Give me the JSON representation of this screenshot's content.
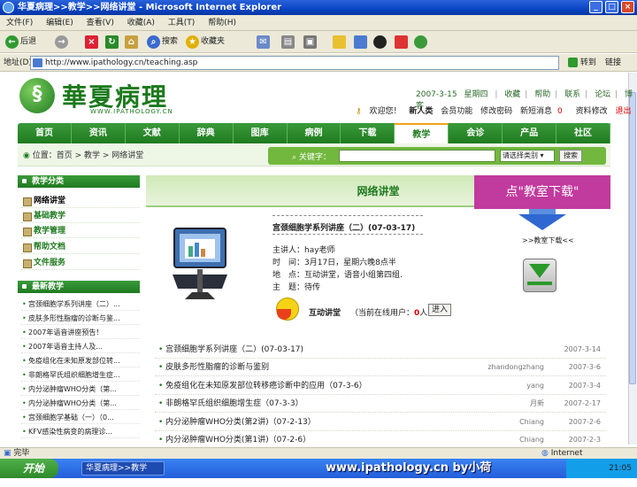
{
  "window": {
    "title": "华夏病理>>教学>>网络讲堂 - Microsoft Internet Explorer"
  },
  "menu": [
    "文件(F)",
    "编辑(E)",
    "查看(V)",
    "收藏(A)",
    "工具(T)",
    "帮助(H)"
  ],
  "toolbar": {
    "back": "后退",
    "search": "搜索",
    "favorites": "收藏夹"
  },
  "address": {
    "label": "地址(D)",
    "url": "http://www.ipathology.cn/teaching.asp",
    "go": "转到",
    "links": "链接"
  },
  "site": {
    "logo_text": "華夏病理",
    "logo_sub": "WWW.IPATHOLOGY.CN",
    "top_links": [
      "2007-3-15",
      "星期四",
      "收藏",
      "帮助",
      "联系",
      "论坛",
      "博客"
    ],
    "user_links": [
      "欢迎您！",
      "新人类",
      "会员功能",
      "修改密码",
      "新短消息",
      "资料修改",
      "退出"
    ],
    "user_count": "0",
    "nav": [
      "首页",
      "资讯",
      "文献",
      "辞典",
      "图库",
      "病例",
      "下载",
      "教学",
      "会诊",
      "产品",
      "社区"
    ],
    "nav_active_index": 7,
    "breadcrumb": "位置：首页 > 教学 > 网络讲堂",
    "search": {
      "label": "关键字：",
      "select": "请选择类别",
      "button": "搜索"
    }
  },
  "sidebar": {
    "categories_title": "教学分类",
    "categories": [
      "网络讲堂",
      "基础教学",
      "教学管理",
      "帮助文档",
      "文件服务"
    ],
    "latest_title": "最新教学",
    "latest": [
      "宫颈细胞学系列讲座（二）...",
      "皮肤多形性脂瘤的诊断与鉴...",
      "2007年语音讲座预告！",
      "2007年语音主持人及...",
      "免疫组化在未知原发部位转...",
      "非朗格罕氏组织细胞增生症...",
      "内分泌肿瘤WHO分类（第...",
      "内分泌肿瘤WHO分类（第...",
      "宫颈细胞学基础（一）（0...",
      "KFV感染性病变的病理诊..."
    ]
  },
  "main": {
    "title": "网络讲堂",
    "callout": "点\"教室下载\"",
    "download_label": ">>教室下载<<",
    "lecture": {
      "title": "宫颈细胞学系列讲座（二）(07-03-17)",
      "speaker": "主讲人：hay老师",
      "time": "时　间：3月17日，星期六晚8点半",
      "place": "地　点：互动讲堂，语音小组第四组.",
      "topic": "主　题：待传"
    },
    "interactive": {
      "title": "互动讲堂",
      "online_prefix": "（当前在线用户：",
      "online_count": "0",
      "online_suffix": "人）",
      "enter": "进入"
    },
    "list": [
      {
        "title": "宫颈细胞学系列讲座（二）(07-03-17)",
        "author": "",
        "date": "2007-3-14"
      },
      {
        "title": "皮肤多形性脂瘤的诊断与鉴别",
        "author": "zhandongzhang",
        "date": "2007-3-6"
      },
      {
        "title": "免疫组化在未知原发部位转移癌诊断中的应用（07-3-6）",
        "author": "yang",
        "date": "2007-3-4"
      },
      {
        "title": "非朗格罕氏组织细胞增生症（07-3-3）",
        "author": "月新",
        "date": "2007-2-17"
      },
      {
        "title": "内分泌肿瘤WHO分类(第2讲)（07-2-13）",
        "author": "Chiang",
        "date": "2007-2-6"
      },
      {
        "title": "内分泌肿瘤WHO分类(第1讲)（07-2-6）",
        "author": "Chiang",
        "date": "2007-2-3"
      }
    ]
  },
  "status": {
    "text": "完毕",
    "zone": "Internet"
  },
  "taskbar": {
    "start": "开始",
    "task": "华夏病理>>教学>>...",
    "watermark": "www.ipathology.cn  by小荷",
    "clock": "21:05"
  }
}
